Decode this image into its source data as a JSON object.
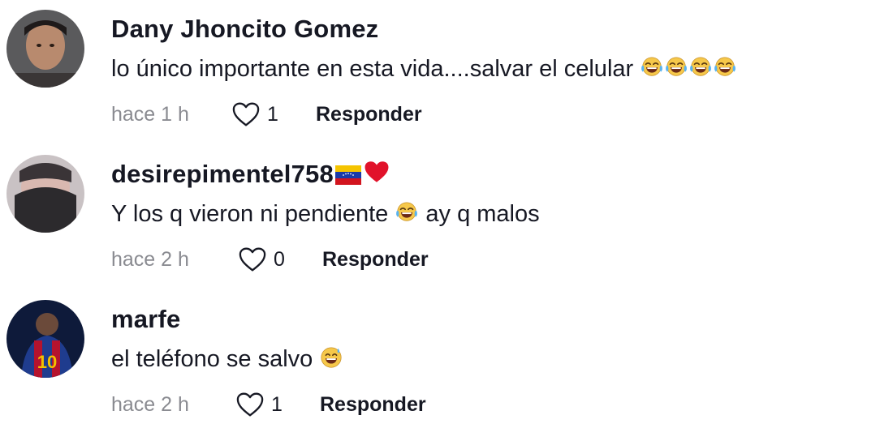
{
  "comments": [
    {
      "username": "Dany Jhoncito Gomez",
      "text": "lo único importante en esta vida....salvar el celular",
      "emojis": [
        "face-with-tears-of-joy-icon",
        "face-with-tears-of-joy-icon",
        "face-with-tears-of-joy-icon",
        "face-with-tears-of-joy-icon"
      ],
      "time": "hace 1 h",
      "likes": "1",
      "reply_label": "Responder"
    },
    {
      "username": "desirepimentel758",
      "username_emojis": [
        "venezuela-flag-icon",
        "red-heart-icon"
      ],
      "text": "Y los q vieron ni pendiente",
      "text_emoji": "face-with-tears-of-joy-icon",
      "text_after": "ay q malos",
      "time": "hace 2 h",
      "likes": "0",
      "reply_label": "Responder"
    },
    {
      "username": "marfe",
      "text": "el teléfono se salvo",
      "emojis": [
        "grinning-face-with-sweat-icon"
      ],
      "time": "hace 2 h",
      "likes": "1",
      "reply_label": "Responder"
    }
  ],
  "colors": {
    "primary_text": "#161823",
    "secondary_text": "#8a8b91",
    "background": "#ffffff"
  }
}
